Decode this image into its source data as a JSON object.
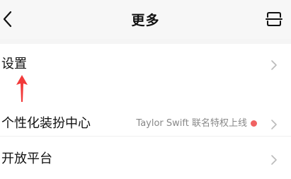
{
  "header": {
    "title": "更多",
    "back_icon": "chevron-left-icon",
    "right_icon": "scan-icon"
  },
  "menu": {
    "items": [
      {
        "label": "设置",
        "value": "",
        "chevron_icon": "chevron-right-icon"
      },
      {
        "label": "个性化装扮中心",
        "value": "Taylor Swift 联名特权上线",
        "chevron_icon": "chevron-right-icon",
        "badge_icon": "red-dot-icon"
      },
      {
        "label": "开放平台",
        "value": "",
        "chevron_icon": "chevron-right-icon"
      }
    ]
  },
  "annotation": {
    "icon": "red-arrow-up-icon"
  },
  "colors": {
    "accent_red": "#f06262",
    "arrow_red": "#f23a3a",
    "text_primary": "#111111",
    "text_secondary": "#888888",
    "chevron": "#bbbbbb",
    "header_bg": "#f7f7f7",
    "list_bg": "#ffffff"
  }
}
